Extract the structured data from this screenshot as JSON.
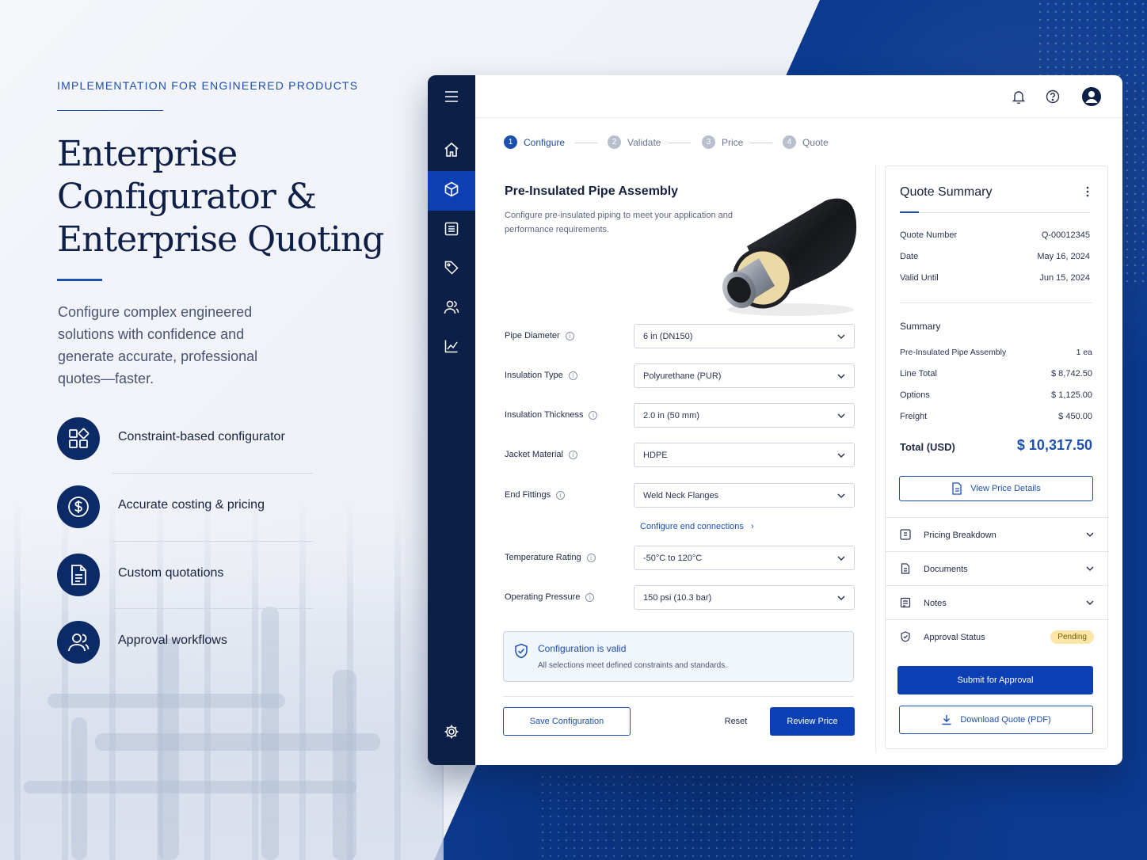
{
  "marketing": {
    "eyebrow": "IMPLEMENTATION FOR ENGINEERED PRODUCTS",
    "headline": [
      "Enterprise",
      "Configurator &",
      "Enterprise Quoting"
    ],
    "lede": "Configure complex engineered solutions with confidence and generate accurate, professional quotes—faster.",
    "features": [
      {
        "label": "Constraint-based configurator",
        "icon": "grid-blocks-icon"
      },
      {
        "label": "Accurate costing & pricing",
        "icon": "dollar-circle-icon"
      },
      {
        "label": "Custom quotations",
        "icon": "document-icon"
      },
      {
        "label": "Approval workflows",
        "icon": "users-icon"
      }
    ]
  },
  "colors": {
    "brand_navy": "#0c1f47",
    "accent_blue": "#1d4fb0",
    "primary_button": "#0b3fb3",
    "pending_badge": "#fbe6a8"
  },
  "sidebar": {
    "items": [
      {
        "icon": "menu-icon"
      },
      {
        "icon": "home-icon"
      },
      {
        "icon": "cube-icon",
        "active": true
      },
      {
        "icon": "list-icon"
      },
      {
        "icon": "tag-icon"
      },
      {
        "icon": "users-icon"
      },
      {
        "icon": "chart-icon"
      },
      {
        "icon": "gear-icon"
      }
    ]
  },
  "topbar": {
    "icons": [
      "bell-icon",
      "help-icon",
      "account-icon"
    ]
  },
  "steps": [
    {
      "num": "1",
      "label": "Configure"
    },
    {
      "num": "2",
      "label": "Validate"
    },
    {
      "num": "3",
      "label": "Price"
    },
    {
      "num": "4",
      "label": "Quote"
    }
  ],
  "product": {
    "title": "Pre-Insulated Pipe Assembly",
    "description": "Configure pre-insulated piping to meet your application and performance requirements."
  },
  "fields": [
    {
      "label": "Pipe Diameter",
      "value": "6 in (DN150)"
    },
    {
      "label": "Insulation Type",
      "value": "Polyurethane (PUR)"
    },
    {
      "label": "Insulation Thickness",
      "value": "2.0 in (50 mm)"
    },
    {
      "label": "Jacket Material",
      "value": "HDPE"
    },
    {
      "label": "End Fittings",
      "value": "Weld Neck Flanges"
    },
    {
      "label": "Temperature Rating",
      "value": "-50°C to 120°C"
    },
    {
      "label": "Operating Pressure",
      "value": "150 psi (10.3 bar)"
    }
  ],
  "configure_link": "Configure end connections",
  "validation": {
    "title": "Configuration is valid",
    "subtitle": "All selections meet defined constraints and standards."
  },
  "actions": {
    "save": "Save Configuration",
    "reset": "Reset",
    "review": "Review Price"
  },
  "quote": {
    "title": "Quote Summary",
    "meta": [
      {
        "k": "Quote Number",
        "v": "Q-00012345"
      },
      {
        "k": "Date",
        "v": "May 16, 2024"
      },
      {
        "k": "Valid Until",
        "v": "Jun 15, 2024"
      }
    ],
    "summary_title": "Summary",
    "lines": [
      {
        "k": "Pre-Insulated Pipe Assembly",
        "v": "1 ea"
      },
      {
        "k": "Line Total",
        "v": "$ 8,742.50"
      },
      {
        "k": "Options",
        "v": "$ 1,125.00"
      },
      {
        "k": "Freight",
        "v": "$ 450.00"
      }
    ],
    "total_label": "Total (USD)",
    "total_value": "$ 10,317.50",
    "view_details": "View Price Details",
    "sections": [
      "Pricing Breakdown",
      "Documents",
      "Notes"
    ],
    "approval_label": "Approval Status",
    "approval_status": "Pending",
    "submit": "Submit for Approval",
    "download": "Download Quote (PDF)"
  }
}
